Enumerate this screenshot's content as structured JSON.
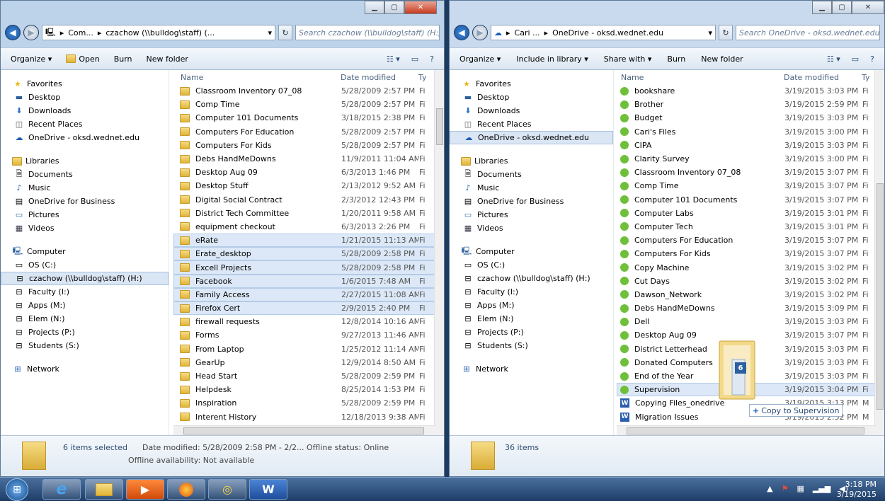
{
  "left_window": {
    "breadcrumb": [
      "Com...",
      "czachow (\\\\bulldog\\staff) (..."
    ],
    "search_placeholder": "Search czachow (\\\\bulldog\\staff) (H:)",
    "toolbar": {
      "organize": "Organize ▾",
      "open": "Open",
      "burn": "Burn",
      "new_folder": "New folder"
    },
    "nav": {
      "favorites": {
        "label": "Favorites",
        "items": [
          "Desktop",
          "Downloads",
          "Recent Places",
          "OneDrive - oksd.wednet.edu"
        ]
      },
      "libraries": {
        "label": "Libraries",
        "items": [
          "Documents",
          "Music",
          "OneDrive for Business",
          "Pictures",
          "Videos"
        ]
      },
      "computer": {
        "label": "Computer",
        "items": [
          "OS (C:)",
          "czachow (\\\\bulldog\\staff) (H:)",
          "Faculty (I:)",
          "Apps (M:)",
          "Elem (N:)",
          "Projects (P:)",
          "Students (S:)"
        ]
      },
      "network": {
        "label": "Network"
      }
    },
    "columns": {
      "name": "Name",
      "date": "Date modified",
      "type": "Ty"
    },
    "files": [
      {
        "name": "Classroom Inventory 07_08",
        "date": "5/28/2009 2:57 PM",
        "type": "Fi"
      },
      {
        "name": "Comp Time",
        "date": "5/28/2009 2:57 PM",
        "type": "Fi"
      },
      {
        "name": "Computer 101 Documents",
        "date": "3/18/2015 2:38 PM",
        "type": "Fi"
      },
      {
        "name": "Computers For Education",
        "date": "5/28/2009 2:57 PM",
        "type": "Fi"
      },
      {
        "name": "Computers For Kids",
        "date": "5/28/2009 2:57 PM",
        "type": "Fi"
      },
      {
        "name": "Debs HandMeDowns",
        "date": "11/9/2011 11:04 AM",
        "type": "Fi"
      },
      {
        "name": "Desktop Aug 09",
        "date": "6/3/2013 1:46 PM",
        "type": "Fi"
      },
      {
        "name": "Desktop Stuff",
        "date": "2/13/2012 9:52 AM",
        "type": "Fi"
      },
      {
        "name": "Digital Social Contract",
        "date": "2/3/2012 12:43 PM",
        "type": "Fi"
      },
      {
        "name": "District Tech Committee",
        "date": "1/20/2011 9:58 AM",
        "type": "Fi"
      },
      {
        "name": "equipment checkout",
        "date": "6/3/2013 2:26 PM",
        "type": "Fi"
      },
      {
        "name": "eRate",
        "date": "1/21/2015 11:13 AM",
        "type": "Fi"
      },
      {
        "name": "Erate_desktop",
        "date": "5/28/2009 2:58 PM",
        "type": "Fi"
      },
      {
        "name": "Excell Projects",
        "date": "5/28/2009 2:58 PM",
        "type": "Fi"
      },
      {
        "name": "Facebook",
        "date": "1/6/2015 7:48 AM",
        "type": "Fi"
      },
      {
        "name": "Family Access",
        "date": "2/27/2015 11:08 AM",
        "type": "Fi"
      },
      {
        "name": "Firefox Cert",
        "date": "2/9/2015 2:40 PM",
        "type": "Fi"
      },
      {
        "name": "firewall requests",
        "date": "12/8/2014 10:16 AM",
        "type": "Fi"
      },
      {
        "name": "Forms",
        "date": "9/27/2013 11:46 AM",
        "type": "Fi"
      },
      {
        "name": "From Laptop",
        "date": "1/25/2012 11:14 AM",
        "type": "Fi"
      },
      {
        "name": "GearUp",
        "date": "12/9/2014 8:50 AM",
        "type": "Fi"
      },
      {
        "name": "Head Start",
        "date": "5/28/2009 2:59 PM",
        "type": "Fi"
      },
      {
        "name": "Helpdesk",
        "date": "8/25/2014 1:53 PM",
        "type": "Fi"
      },
      {
        "name": "Inspiration",
        "date": "5/28/2009 2:59 PM",
        "type": "Fi"
      },
      {
        "name": "Interent History",
        "date": "12/18/2013 9:38 AM",
        "type": "Fi"
      }
    ],
    "details": {
      "selected": "6 items selected",
      "date_modified": "Date modified: 5/28/2009 2:58 PM - 2/2... Offline status: Online",
      "offline": "Offline availability: Not available"
    }
  },
  "right_window": {
    "breadcrumb": [
      "Cari ...",
      "OneDrive - oksd.wednet.edu"
    ],
    "search_placeholder": "Search OneDrive - oksd.wednet.edu",
    "toolbar": {
      "organize": "Organize ▾",
      "include": "Include in library ▾",
      "share": "Share with ▾",
      "burn": "Burn",
      "new_folder": "New folder"
    },
    "nav": {
      "favorites": {
        "label": "Favorites",
        "items": [
          "Desktop",
          "Downloads",
          "Recent Places",
          "OneDrive - oksd.wednet.edu"
        ]
      },
      "libraries": {
        "label": "Libraries",
        "items": [
          "Documents",
          "Music",
          "OneDrive for Business",
          "Pictures",
          "Videos"
        ]
      },
      "computer": {
        "label": "Computer",
        "items": [
          "OS (C:)",
          "czachow (\\\\bulldog\\staff) (H:)",
          "Faculty (I:)",
          "Apps (M:)",
          "Elem (N:)",
          "Projects (P:)",
          "Students (S:)"
        ]
      },
      "network": {
        "label": "Network"
      }
    },
    "columns": {
      "name": "Name",
      "date": "Date modified",
      "type": "Ty"
    },
    "files": [
      {
        "name": "bookshare",
        "date": "3/19/2015 3:03 PM",
        "type": "Fi"
      },
      {
        "name": "Brother",
        "date": "3/19/2015 2:59 PM",
        "type": "Fi"
      },
      {
        "name": "Budget",
        "date": "3/19/2015 3:03 PM",
        "type": "Fi"
      },
      {
        "name": "Cari's Files",
        "date": "3/19/2015 3:00 PM",
        "type": "Fi"
      },
      {
        "name": "CIPA",
        "date": "3/19/2015 3:03 PM",
        "type": "Fi"
      },
      {
        "name": "Clarity Survey",
        "date": "3/19/2015 3:00 PM",
        "type": "Fi"
      },
      {
        "name": "Classroom Inventory 07_08",
        "date": "3/19/2015 3:07 PM",
        "type": "Fi"
      },
      {
        "name": "Comp Time",
        "date": "3/19/2015 3:07 PM",
        "type": "Fi"
      },
      {
        "name": "Computer 101 Documents",
        "date": "3/19/2015 3:07 PM",
        "type": "Fi"
      },
      {
        "name": "Computer Labs",
        "date": "3/19/2015 3:01 PM",
        "type": "Fi"
      },
      {
        "name": "Computer Tech",
        "date": "3/19/2015 3:01 PM",
        "type": "Fi"
      },
      {
        "name": "Computers For Education",
        "date": "3/19/2015 3:07 PM",
        "type": "Fi"
      },
      {
        "name": "Computers For Kids",
        "date": "3/19/2015 3:07 PM",
        "type": "Fi"
      },
      {
        "name": "Copy Machine",
        "date": "3/19/2015 3:02 PM",
        "type": "Fi"
      },
      {
        "name": "Cut Days",
        "date": "3/19/2015 3:02 PM",
        "type": "Fi"
      },
      {
        "name": "Dawson_Network",
        "date": "3/19/2015 3:02 PM",
        "type": "Fi"
      },
      {
        "name": "Debs HandMeDowns",
        "date": "3/19/2015 3:09 PM",
        "type": "Fi"
      },
      {
        "name": "Dell",
        "date": "3/19/2015 3:03 PM",
        "type": "Fi"
      },
      {
        "name": "Desktop Aug 09",
        "date": "3/19/2015 3:07 PM",
        "type": "Fi"
      },
      {
        "name": "District Letterhead",
        "date": "3/19/2015 3:03 PM",
        "type": "Fi"
      },
      {
        "name": "Donated Computers",
        "date": "3/19/2015 3:03 PM",
        "type": "Fi"
      },
      {
        "name": "End of the Year",
        "date": "3/19/2015 3:03 PM",
        "type": "Fi"
      },
      {
        "name": "Supervision",
        "date": "3/19/2015 3:04 PM",
        "type": "Fi"
      },
      {
        "name": "Copying Files_onedrive",
        "date": "3/19/2015 3:13 PM",
        "type": "M"
      },
      {
        "name": "Migration Issues",
        "date": "3/19/2015 2:52 PM",
        "type": "M"
      }
    ],
    "details": {
      "count": "36 items"
    }
  },
  "drag": {
    "count": "6",
    "tooltip": "Copy to Supervision"
  },
  "taskbar": {
    "time": "3:18 PM",
    "date": "3/19/2015"
  },
  "colors": {
    "selection": "#dce8f7",
    "folder": "#e8c04a",
    "taskbar": "#2a4d7a"
  }
}
